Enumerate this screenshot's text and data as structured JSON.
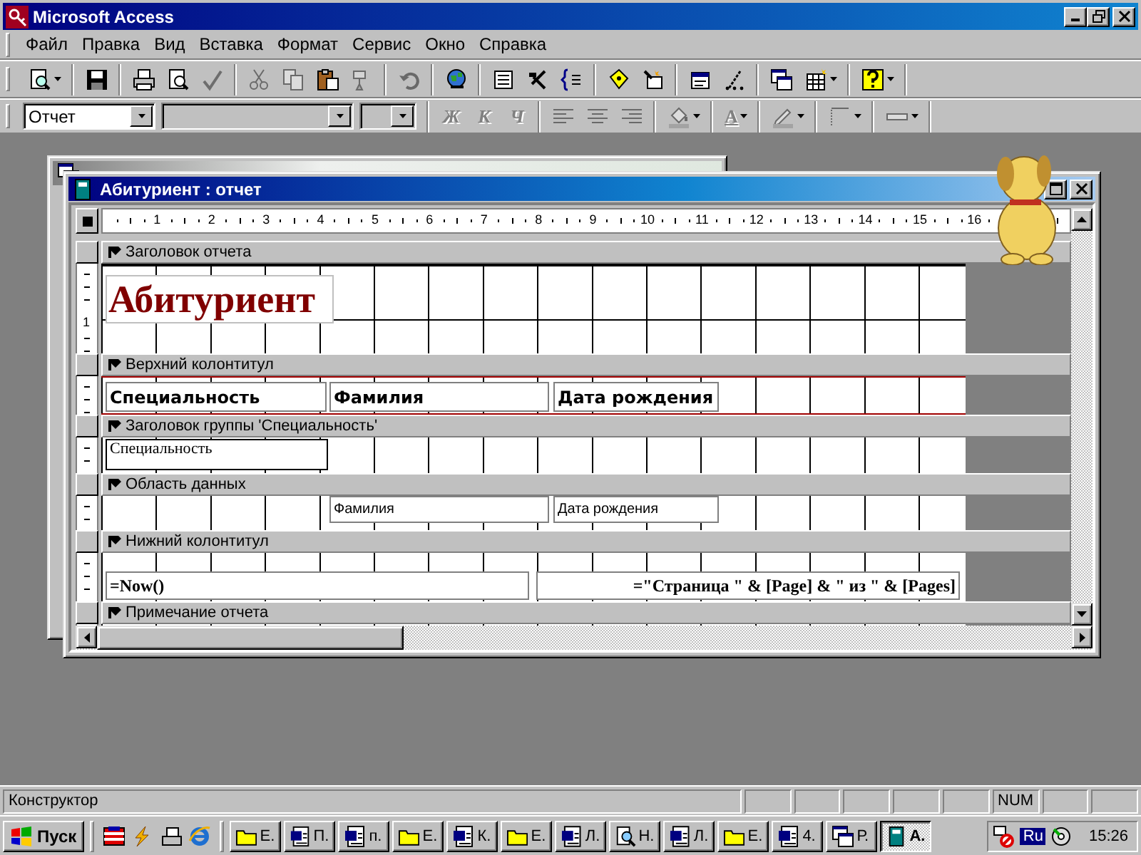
{
  "app_title": "Microsoft Access",
  "menu": [
    "Файл",
    "Правка",
    "Вид",
    "Вставка",
    "Формат",
    "Сервис",
    "Окно",
    "Справка"
  ],
  "toolbar_1": [
    [
      {
        "kind": "view",
        "disabled": false,
        "dropdown": true
      }
    ],
    [
      {
        "kind": "save",
        "disabled": false,
        "dropdown": false
      }
    ],
    [
      {
        "kind": "print",
        "disabled": false,
        "dropdown": false
      },
      {
        "kind": "preview",
        "disabled": false,
        "dropdown": false
      },
      {
        "kind": "spelling",
        "disabled": true,
        "dropdown": false
      }
    ],
    [
      {
        "kind": "cut",
        "disabled": true,
        "dropdown": false
      },
      {
        "kind": "copy",
        "disabled": true,
        "dropdown": false
      },
      {
        "kind": "paste",
        "disabled": false,
        "dropdown": false
      },
      {
        "kind": "painter",
        "disabled": true,
        "dropdown": false
      }
    ],
    [
      {
        "kind": "undo",
        "disabled": true,
        "dropdown": false
      }
    ],
    [
      {
        "kind": "hyperlink",
        "disabled": false,
        "dropdown": false
      }
    ],
    [
      {
        "kind": "fieldlist",
        "disabled": false,
        "dropdown": false
      },
      {
        "kind": "build",
        "disabled": false,
        "dropdown": false
      },
      {
        "kind": "code",
        "disabled": false,
        "dropdown": false
      }
    ],
    [
      {
        "kind": "autoformat",
        "disabled": false,
        "dropdown": false
      },
      {
        "kind": "wizard",
        "disabled": false,
        "dropdown": false
      }
    ],
    [
      {
        "kind": "properties",
        "disabled": false,
        "dropdown": false
      },
      {
        "kind": "builder",
        "disabled": false,
        "dropdown": false
      }
    ],
    [
      {
        "kind": "dbwindow",
        "disabled": false,
        "dropdown": false
      },
      {
        "kind": "newobject",
        "disabled": false,
        "dropdown": true
      }
    ],
    [
      {
        "kind": "help",
        "disabled": false,
        "dropdown": true
      }
    ]
  ],
  "format_toolbar": {
    "object_value": "Отчет",
    "groups": [
      [
        {
          "kind": "letter",
          "text": "Ж",
          "disabled": true,
          "dropdown": false
        },
        {
          "kind": "letter",
          "text": "К",
          "disabled": true,
          "dropdown": false
        },
        {
          "kind": "letter",
          "text": "Ч",
          "disabled": true,
          "dropdown": false
        }
      ],
      [
        {
          "kind": "align_left",
          "disabled": true,
          "dropdown": false
        },
        {
          "kind": "align_center",
          "disabled": true,
          "dropdown": false
        },
        {
          "kind": "align_right",
          "disabled": true,
          "dropdown": false
        }
      ],
      [
        {
          "kind": "fill",
          "disabled": true,
          "dropdown": true
        }
      ],
      [
        {
          "kind": "fontcolor",
          "text": "A",
          "disabled": true,
          "dropdown": true
        }
      ],
      [
        {
          "kind": "linecolor",
          "disabled": true,
          "dropdown": true
        }
      ],
      [
        {
          "kind": "border",
          "disabled": true,
          "dropdown": true
        }
      ],
      [
        {
          "kind": "linewidth",
          "disabled": true,
          "dropdown": true
        }
      ]
    ]
  },
  "report_window": {
    "title": "Абитуриент : отчет",
    "ruler": [
      "1",
      "2",
      "3",
      "4",
      "5",
      "6",
      "7",
      "8",
      "9",
      "10",
      "11",
      "12",
      "13",
      "14",
      "15",
      "16"
    ],
    "sections": [
      {
        "title": "Заголовок отчета",
        "ruler_mark": "1",
        "controls": [
          {
            "kind": "title_label",
            "text": "Абитуриент"
          }
        ]
      },
      {
        "title": "Верхний колонтитул",
        "controls": [
          {
            "kind": "header_label",
            "text": "Специальность"
          },
          {
            "kind": "header_label",
            "text": "Фамилия"
          },
          {
            "kind": "header_label",
            "text": "Дата рождения"
          }
        ]
      },
      {
        "title": "Заголовок группы 'Специальность'",
        "controls": [
          {
            "kind": "text_box",
            "text": "Специальность"
          }
        ]
      },
      {
        "title": "Область данных",
        "controls": [
          {
            "kind": "field_box",
            "text": "Фамилия"
          },
          {
            "kind": "field_box",
            "text": "Дата рождения"
          }
        ]
      },
      {
        "title": "Нижний колонтитул",
        "controls": [
          {
            "kind": "expression_box",
            "text": "=Now()"
          },
          {
            "kind": "expression_box",
            "text": "=\"Страница \" & [Page] & \" из \" & [Pages]"
          }
        ]
      },
      {
        "title": "Примечание отчета"
      }
    ]
  },
  "status_bar": {
    "message": "Конструктор",
    "indicator": "NUM"
  },
  "taskbar": {
    "start": "Пуск",
    "quick_launch": [
      {
        "kind": "desktop"
      },
      {
        "kind": "lightning"
      },
      {
        "kind": "device"
      },
      {
        "kind": "browser"
      }
    ],
    "tasks": [
      {
        "kind": "folder",
        "label": "Е.",
        "selected": false
      },
      {
        "kind": "document",
        "label": "П.",
        "selected": false
      },
      {
        "kind": "document",
        "label": "п.",
        "selected": false
      },
      {
        "kind": "folder",
        "label": "Е.",
        "selected": false
      },
      {
        "kind": "document",
        "label": "К.",
        "selected": false
      },
      {
        "kind": "folder",
        "label": "Е.",
        "selected": false
      },
      {
        "kind": "document",
        "label": "Л.",
        "selected": false
      },
      {
        "kind": "search",
        "label": "Н.",
        "selected": false
      },
      {
        "kind": "document",
        "label": "Л.",
        "selected": false
      },
      {
        "kind": "folder",
        "label": "Е.",
        "selected": false
      },
      {
        "kind": "document",
        "label": "4.",
        "selected": false
      },
      {
        "kind": "windows",
        "label": "Р.",
        "selected": false
      },
      {
        "kind": "database",
        "label": "А.",
        "selected": true
      }
    ],
    "language": "Ru",
    "clock": "15:26"
  }
}
